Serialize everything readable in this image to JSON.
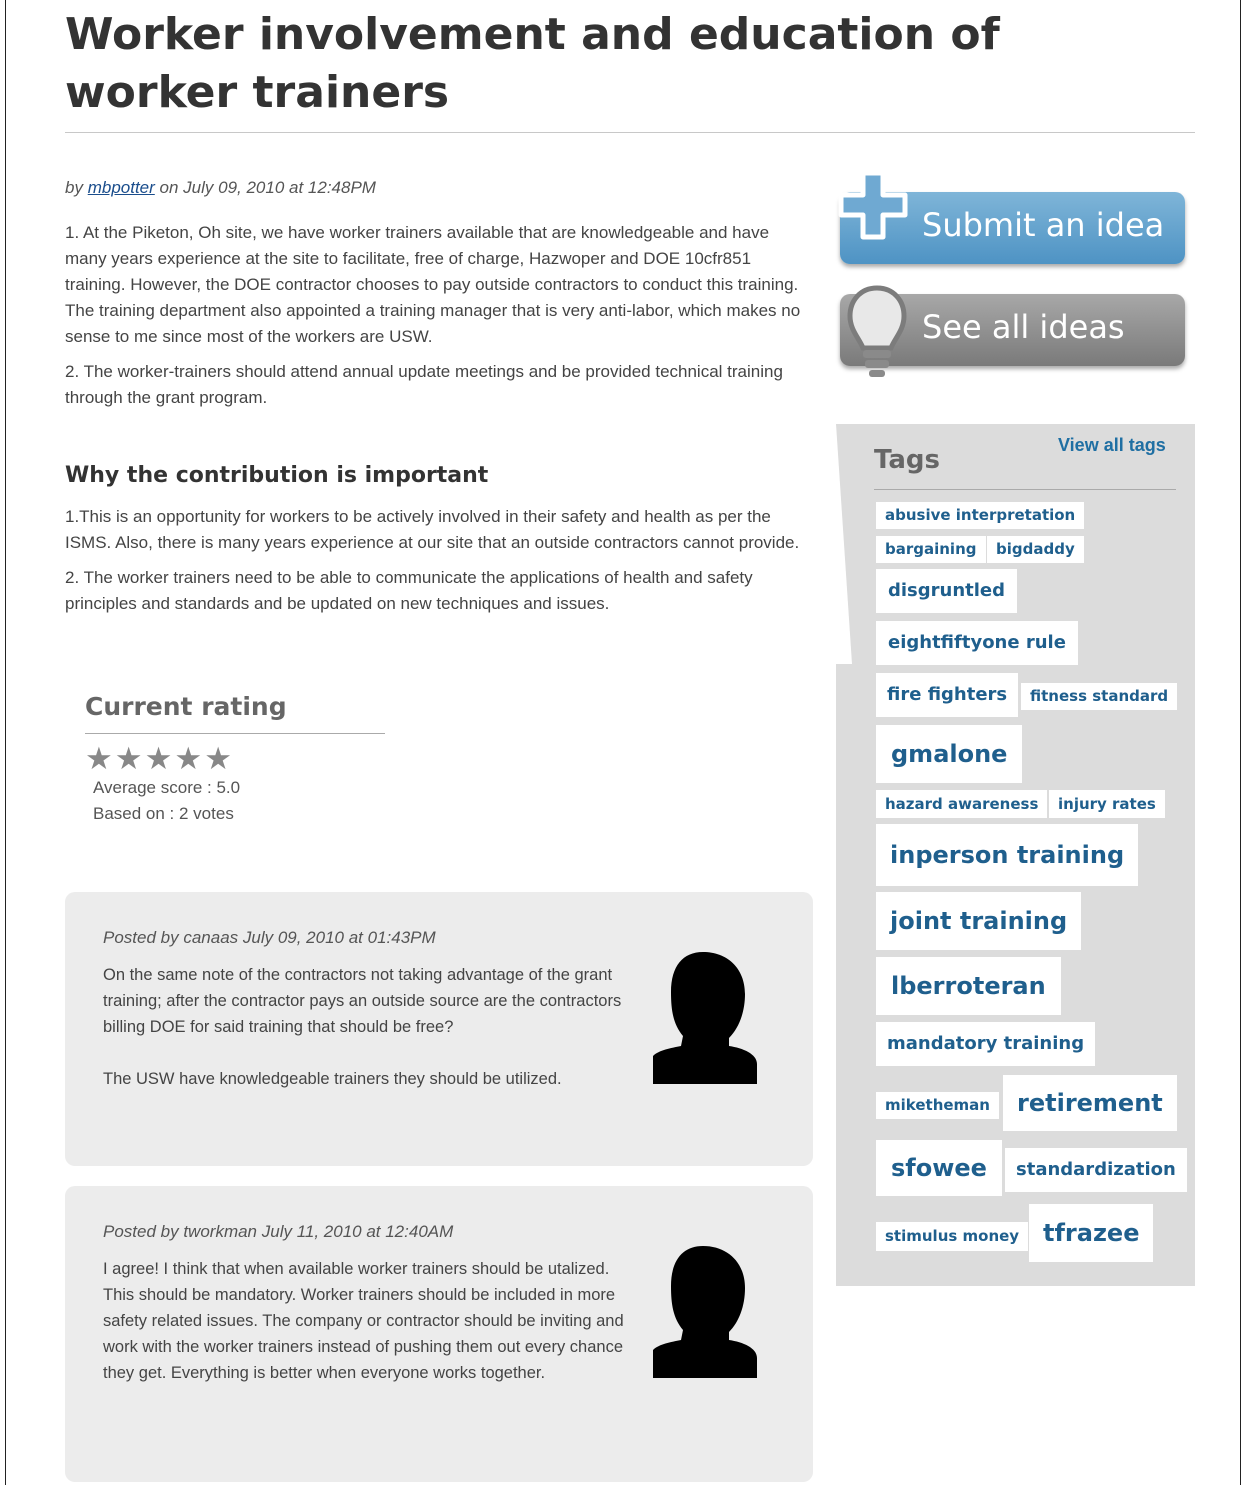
{
  "idea": {
    "title": "Worker involvement and education of worker trainers",
    "byline_prefix": "by",
    "author": "mbpotter",
    "byline_date": "on July 09, 2010 at 12:48PM",
    "paragraphs": [
      "1. At the Piketon, Oh site, we have worker trainers available that are knowledgeable and have many years experience at the site to facilitate, free of charge, Hazwoper and DOE 10cfr851 training.  However, the DOE contractor chooses to pay outside contractors to conduct this training.  The training department also appointed a training manager that is very anti-labor, which makes no sense to me since most of the workers are USW.",
      "2.  The worker-trainers should attend annual update meetings and be provided technical training through the grant program."
    ],
    "why_heading": "Why the contribution is important",
    "why_paragraphs": [
      "1.This is an opportunity for workers to be actively involved in their safety and health as per the ISMS.    Also, there is many years experience at our site that an outside contractors cannot provide.",
      "2. The worker trainers need to be able to communicate the applications of health and safety principles and standards and be updated on new techniques and issues."
    ]
  },
  "rating": {
    "title": "Current rating",
    "stars": 5,
    "average": "Average score : 5.0",
    "votes": "Based on : 2 votes"
  },
  "comments": [
    {
      "posted": "Posted by canaas July 09, 2010 at 01:43PM",
      "lines": [
        "On the same note of the contractors not taking advantage of the grant training; after the contractor pays an outside source are the contractors billing DOE for said training that should be free?",
        "The USW have knowledgeable trainers they should be utilized."
      ]
    },
    {
      "posted": "Posted by tworkman July 11, 2010 at 12:40AM",
      "lines": [
        "I agree! I think that when available worker trainers should be utalized. This should be mandatory. Worker trainers should be included in more safety related issues. The company or contractor should be inviting and work with the worker trainers instead of pushing them out every chance they get. Everything is better when everyone works together."
      ]
    }
  ],
  "sidebar": {
    "submit_label": "Submit an idea",
    "see_all_label": "See all ideas",
    "tags_title": "Tags",
    "view_all_tags": "View all tags",
    "tags": [
      "abusive interpretation",
      "bargaining",
      "bigdaddy",
      "disgruntled",
      "eightfiftyone rule",
      "fire fighters",
      "fitness standard",
      "gmalone",
      "hazard awareness",
      "injury rates",
      "inperson training",
      "joint training",
      "lberroteran",
      "mandatory training",
      "miketheman",
      "retirement",
      "sfowee",
      "standardization",
      "stimulus money",
      "tfrazee"
    ]
  },
  "colors": {
    "accent": "#1f5f8d",
    "submit_button": "#5a9ccb",
    "see_all_button": "#8a8a8a",
    "tags_panel": "#dcdcdc",
    "comment_bg": "#ececec"
  }
}
